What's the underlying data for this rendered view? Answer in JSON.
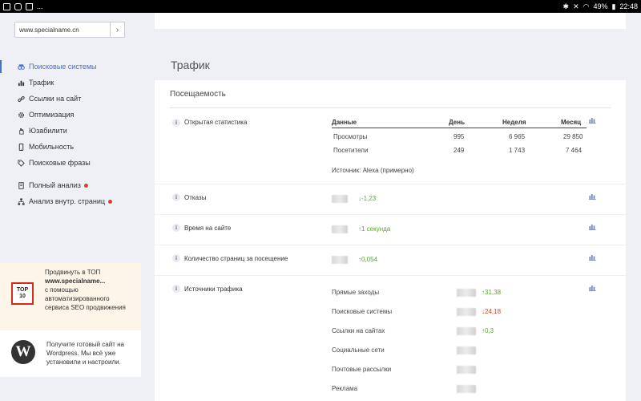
{
  "statusbar": {
    "left_dots": "...",
    "battery": "49%",
    "time": "22:48"
  },
  "sidebar": {
    "search": {
      "value": "www.specialname.cn",
      "placeholder": "",
      "go": "›"
    },
    "nav": [
      {
        "label": "Поисковые системы",
        "icon": "search-engines-icon",
        "active": true
      },
      {
        "label": "Трафик",
        "icon": "bar-chart-icon"
      },
      {
        "label": "Ссылки на сайт",
        "icon": "link-icon"
      },
      {
        "label": "Оптимизация",
        "icon": "gear-icon"
      },
      {
        "label": "Юзабилити",
        "icon": "hand-icon"
      },
      {
        "label": "Мобильность",
        "icon": "mobile-icon"
      },
      {
        "label": "Поисковые фразы",
        "icon": "tags-icon"
      }
    ],
    "nav_extra": [
      {
        "label": "Полный анализ",
        "badge_color": "#e03a2f"
      },
      {
        "label": "Анализ внутр. страниц",
        "badge_color": "#e03a2f"
      }
    ],
    "promo": {
      "logo_line1": "TOP",
      "logo_line2": "10",
      "line1": "Продвинуть в ТОП",
      "line2": "www.specialname...",
      "line3": "с помощью автоматизированного сервиса SEO продвижения"
    },
    "wordpress": {
      "logo": "W",
      "text": "Получите готовый сайт на Wordpress. Мы всё уже установили и настроили."
    }
  },
  "main": {
    "section_title": "Трафик",
    "card_title": "Посещаемость",
    "open_stats": {
      "label": "Открытая статистика",
      "headers": [
        "Данные",
        "День",
        "Неделя",
        "Месяц"
      ],
      "rows": [
        [
          "Просмотры",
          "995",
          "6 965",
          "29 850"
        ],
        [
          "Посетители",
          "249",
          "1 743",
          "7 464"
        ]
      ],
      "source": "Источник: Alexa (примерно)"
    },
    "bounces": {
      "label": "Отказы",
      "delta": "-1,23",
      "dir": "down"
    },
    "time_on_site": {
      "label": "Время на сайте",
      "delta": "1 секунда",
      "dir": "up"
    },
    "pages_per_visit": {
      "label": "Количество страниц за посещение",
      "delta": "0,054",
      "dir": "up"
    },
    "traffic_sources": {
      "label": "Источники трафика",
      "items": [
        {
          "label": "Прямые заходы",
          "delta": "31,38",
          "dir": "up"
        },
        {
          "label": "Поисковые системы",
          "delta": "24,18",
          "dir": "down"
        },
        {
          "label": "Ссылки на сайтах",
          "delta": "0,3",
          "dir": "up"
        },
        {
          "label": "Социальные сети",
          "delta": "",
          "dir": ""
        },
        {
          "label": "Почтовые рассылки",
          "delta": "",
          "dir": ""
        },
        {
          "label": "Реклама",
          "delta": "",
          "dir": ""
        }
      ]
    },
    "info_glyph": "i"
  },
  "colors": {
    "accent": "#4a6fc7",
    "up": "#5aa72e",
    "down": "#d9402b",
    "promo_bg": "#fdf5e8"
  }
}
